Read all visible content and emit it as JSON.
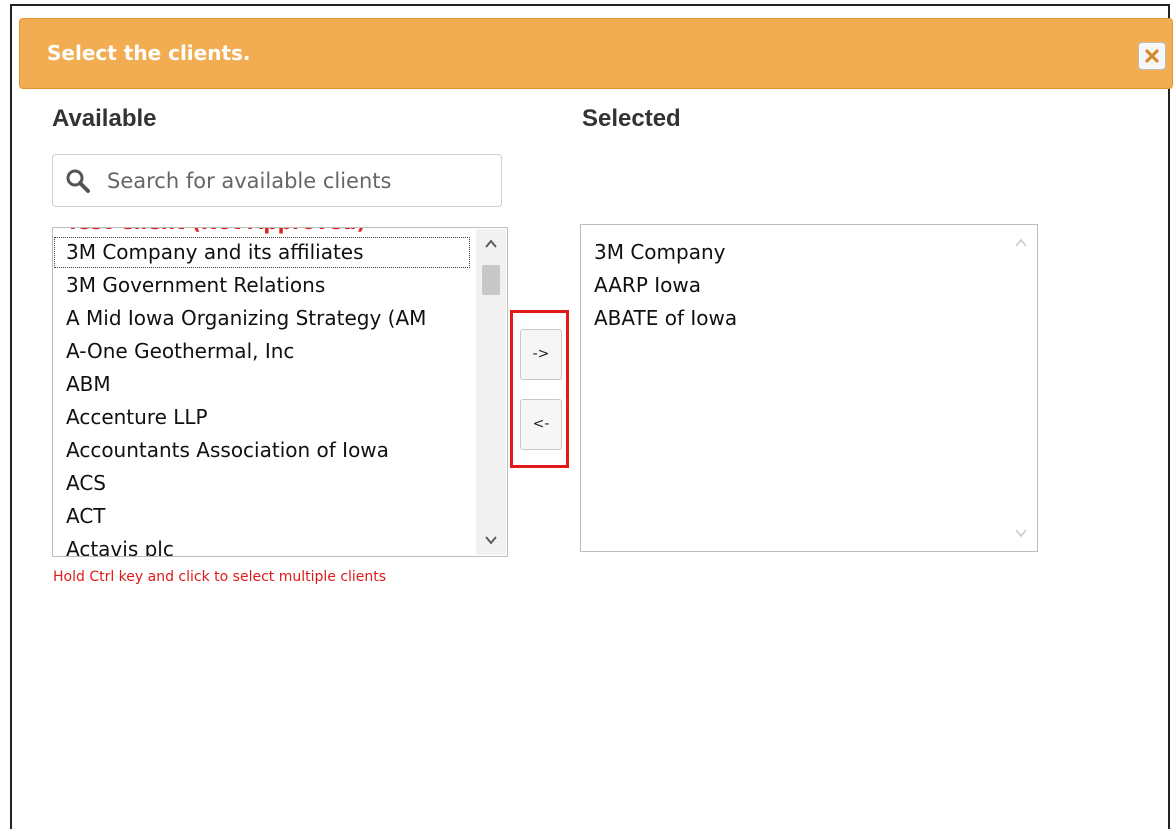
{
  "dialog": {
    "title": "Select the clients.",
    "close_icon": "close-x-icon",
    "accent_color": "#f2ad52"
  },
  "available": {
    "heading": "Available",
    "search_placeholder": "Search for available clients",
    "search_value": "",
    "partial_top_item": "Test Client (Not Approved)",
    "items": [
      "3M Company and its affiliates",
      "3M Government Relations",
      "A Mid Iowa Organizing Strategy (AM",
      "A-One Geothermal, Inc",
      "ABM",
      "Accenture LLP",
      "Accountants Association of Iowa",
      "ACS",
      "ACT",
      "Actavis plc"
    ],
    "focused_item": "3M Company and its affiliates"
  },
  "selected": {
    "heading": "Selected",
    "items": [
      "3M Company",
      "AARP Iowa",
      "ABATE of Iowa"
    ]
  },
  "buttons": {
    "add_label": "->",
    "remove_label": "<-"
  },
  "hint": "Hold Ctrl key and click to select multiple clients"
}
